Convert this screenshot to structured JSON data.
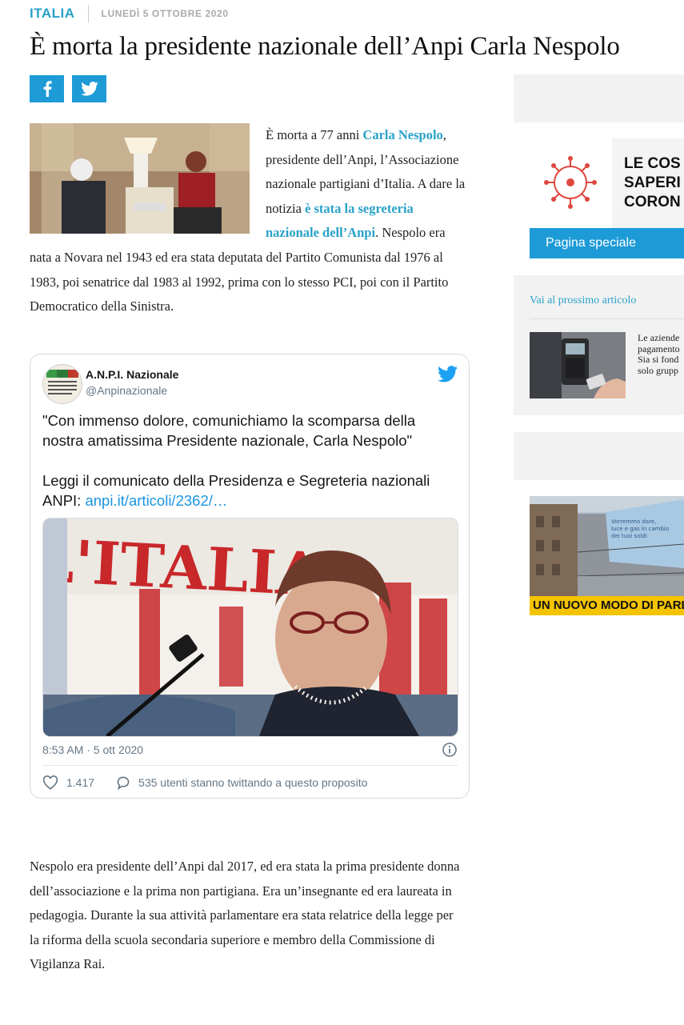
{
  "header": {
    "section": "ITALIA",
    "date": "LUNEDÌ 5 OTTOBRE 2020",
    "title": "È morta la presidente nazionale dell’Anpi Carla Nespolo"
  },
  "share": {
    "facebook_icon": "facebook-icon",
    "twitter_icon": "twitter-icon",
    "brand_color": "#1d9bd7"
  },
  "article": {
    "p1_before_link1": "È morta a 77 anni ",
    "link1": "Carla Nespolo",
    "p1_mid": ", presidente dell’Anpi, l’Associazione nazionale partigiani d’Italia. A dare la notizia ",
    "link2": "è stata la segreteria nazionale dell’Anpi",
    "p1_after": ". Nespolo era nata a Novara nel 1943 ed era stata deputata del Partito Comunista dal 1976 al 1983, poi senatrice dal 1983 al 1992, prima con lo stesso PCI, poi con il Partito Democratico della Sinistra.",
    "p2": "Nespolo era presidente dell’Anpi dal 2017, ed era stata la prima presidente donna dell’associazione e la prima non partigiana. Era un’insegnante ed era laureata in pedagogia. Durante la sua attività parlamentare era stata relatrice della legge per la riforma della scuola secondaria superiore e membro della Commissione di Vigilanza Rai."
  },
  "tweet": {
    "name": "A.N.P.I. Nazionale",
    "handle": "@Anpinazionale",
    "text1": "\"Con immenso dolore, comunichiamo la scomparsa della nostra amatissima Presidente nazionale, Carla Nespolo\"",
    "text2": "Leggi il comunicato della Presidenza e Segreteria nazionali ANPI: ",
    "link": "anpi.it/articoli/2362/…",
    "time": "8:53 AM · 5 ott 2020",
    "likes": "1.417",
    "replies": "535 utenti stanno twittando a questo proposito",
    "banner_text": "L'ITALIA"
  },
  "sidebar": {
    "ad1_title": "LE COS SAPERI CORON",
    "ad1_button": "Pagina speciale",
    "next_label": "Vai al prossimo articolo",
    "next_text": "Le aziende pagamento Sia si fond solo grupp",
    "ad2_billboard": "Vorremmo dare, luce e gas in cambio dei tuoi soldi.",
    "ad2_bar": "UN NUOVO MODO DI PARLAR"
  }
}
